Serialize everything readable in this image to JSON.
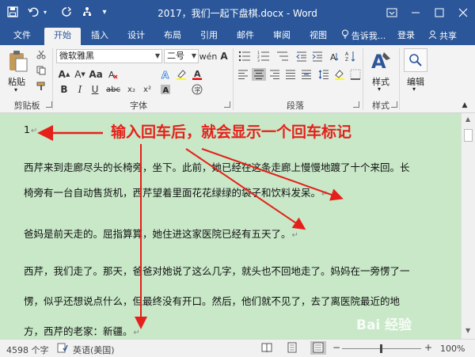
{
  "title_bar": {
    "title": "2017，我们一起下盘棋.docx - Word",
    "qat": {
      "save_icon": "save-icon",
      "undo_icon": "undo-icon",
      "redo_icon": "redo-icon",
      "touch_icon": "touch-mode-icon"
    },
    "window": {
      "ribbon_options_icon": "ribbon-display-icon",
      "min_icon": "minimize-icon",
      "max_icon": "maximize-icon",
      "close_icon": "close-icon"
    }
  },
  "tabs": [
    "文件",
    "开始",
    "插入",
    "设计",
    "布局",
    "引用",
    "邮件",
    "审阅",
    "视图"
  ],
  "active_tab": "开始",
  "tell_me": "告诉我...",
  "signin": "登录",
  "share": "共享",
  "ribbon": {
    "clipboard": {
      "paste_label": "粘贴",
      "group_label": "剪贴板"
    },
    "font": {
      "font_name": "微软雅黑",
      "font_size": "二号",
      "bold": "B",
      "italic": "I",
      "underline": "U",
      "strike": "abc",
      "sub": "x₂",
      "sup": "x²",
      "group_label": "字体"
    },
    "paragraph": {
      "group_label": "段落"
    },
    "styles": {
      "label": "样式",
      "group_label": "样式"
    },
    "editing": {
      "label": "编辑"
    }
  },
  "document": {
    "paragraphs": [
      "1",
      "西芹来到走廊尽头的长椅旁，坐下。此前，她已经在这条走廊上慢慢地踱了十个来回。长",
      "椅旁有一台自动售货机，西芹望着里面花花绿绿的袋子和饮料发呆。",
      "爸妈是前天走的。屈指算算，她住进这家医院已经有五天了。",
      "西芹，我们走了。那天，爸爸对她说了这么几字，就头也不回地走了。妈妈在一旁愣了一",
      "愣，似乎还想说点什么，但最终没有开口。然后，他们就不见了，去了离医院最近的地",
      "方，西芹的老家：新疆。"
    ],
    "paragraph_mark": "↵"
  },
  "annotation": {
    "text": "输入回车后，就会显示一个回车标记",
    "color": "#e5201a"
  },
  "status_bar": {
    "word_count": "4598 个字",
    "language": "英语(美国)",
    "zoom": "100%",
    "zoom_out": "−",
    "zoom_in": "+"
  },
  "watermark": "Bai 经验",
  "colors": {
    "accent": "#2b579a",
    "doc_bg": "#c8e8c8"
  }
}
